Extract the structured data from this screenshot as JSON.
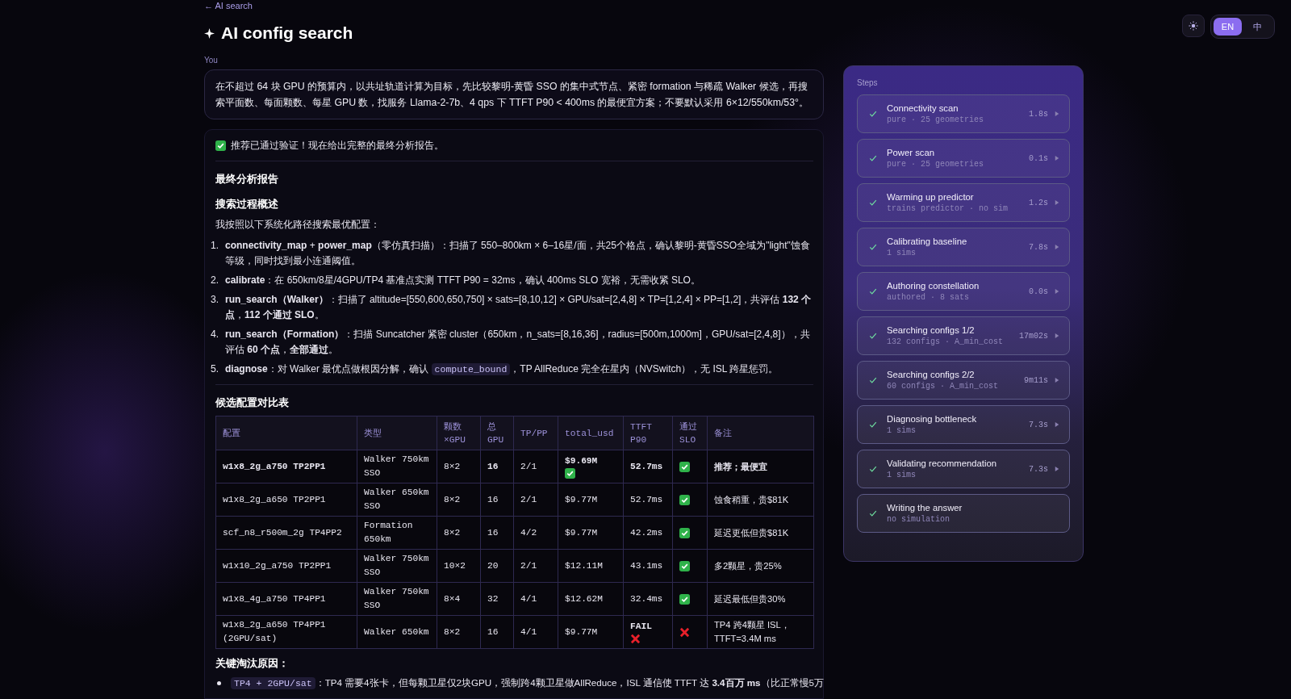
{
  "back_link": "← AI search",
  "title": "AI config search",
  "prompt": {
    "label": "You",
    "text": "在不超过 64 块 GPU 的预算内，以共址轨道计算为目标，先比较黎明-黄昏 SSO 的集中式节点、紧密 formation 与稀疏 Walker 候选，再搜索平面数、每面颗数、每星 GPU 数，找服务 Llama-2-7b、4 qps 下 TTFT P90 < 400ms 的最便宜方案；不要默认采用 6×12/550km/53°。"
  },
  "answer": {
    "verified": {
      "ok": true,
      "text": "推荐已通过验证！现在给出完整的最终分析报告。"
    },
    "heading": "最终分析报告",
    "subheading": "搜索过程概述",
    "intro": "我按照以下系统化路径搜索最优配置：",
    "steps_list": [
      {
        "num": "1.",
        "parts": [
          {
            "kind": "text",
            "text": "**connectivity_map** + **power_map**（零仿真扫描）：扫描了 550–800km × 6–16星/面，共25个格点，确认黎明-黄昏SSO全域为\"light\"蚀食等级，同时找到最小连通阈值。"
          }
        ]
      },
      {
        "num": "2.",
        "parts": [
          {
            "kind": "text",
            "text": "**calibrate**：在 650km/8星/4GPU/TP4 基准点实测 TTFT P90 = 32ms，确认 400ms SLO 宽裕，无需收紧 SLO。"
          }
        ]
      },
      {
        "num": "3.",
        "parts": [
          {
            "kind": "text",
            "text": "**run_search（Walker）**：扫描了 altitude=[550,600,650,750] × sats=[8,10,12] × GPU/sat=[2,4,8] × TP=[1,2,4] × PP=[1,2]，共评估 **132 个点**，**112 个通过 SLO**。"
          }
        ]
      },
      {
        "num": "4.",
        "parts": [
          {
            "kind": "text",
            "text": "**run_search（Formation）**：扫描 Suncatcher 紧密 cluster（650km，n_sats=[8,16,36]，radius=[500m,1000m]，GPU/sat=[2,4,8]），共评估 **60 个点**，**全部通过**。"
          }
        ]
      },
      {
        "num": "5.",
        "parts": [
          {
            "kind": "text",
            "text": "**diagnose**：对 Walker 最优点做根因分解，确认 "
          },
          {
            "kind": "code",
            "text": "compute_bound"
          },
          {
            "kind": "text",
            "text": "，TP AllReduce 完全在星内（NVSwitch），无 ISL 跨星惩罚。"
          }
        ]
      }
    ],
    "table_heading": "候选配置对比表",
    "table": {
      "columns": [
        "配置",
        "类型",
        "颗数 ×GPU",
        "总 GPU",
        "TP/PP",
        "total_usd",
        "TTFT P90",
        "通过 SLO",
        "备注"
      ],
      "rows": [
        {
          "recommended": true,
          "config": "w1x8_2g_a750 TP2PP1",
          "type": "Walker 750km SSO",
          "sats": "8×2",
          "gpus": "16",
          "tppp": "2/1",
          "usd": "$9.69M",
          "usd_ok": true,
          "ttft": "52.7ms",
          "ttft_fail": false,
          "pass": true,
          "note": "推荐；最便宜"
        },
        {
          "recommended": false,
          "config": "w1x8_2g_a650 TP2PP1",
          "type": "Walker 650km SSO",
          "sats": "8×2",
          "gpus": "16",
          "tppp": "2/1",
          "usd": "$9.77M",
          "usd_ok": false,
          "ttft": "52.7ms",
          "ttft_fail": false,
          "pass": true,
          "note": "蚀食稍重，贵$81K"
        },
        {
          "recommended": false,
          "config": "scf_n8_r500m_2g TP4PP2",
          "type": "Formation 650km",
          "sats": "8×2",
          "gpus": "16",
          "tppp": "4/2",
          "usd": "$9.77M",
          "usd_ok": false,
          "ttft": "42.2ms",
          "ttft_fail": false,
          "pass": true,
          "note": "延迟更低但贵$81K"
        },
        {
          "recommended": false,
          "config": "w1x10_2g_a750 TP2PP1",
          "type": "Walker 750km SSO",
          "sats": "10×2",
          "gpus": "20",
          "tppp": "2/1",
          "usd": "$12.11M",
          "usd_ok": false,
          "ttft": "43.1ms",
          "ttft_fail": false,
          "pass": true,
          "note": "多2颗星，贵25%"
        },
        {
          "recommended": false,
          "config": "w1x8_4g_a750 TP4PP1",
          "type": "Walker 750km SSO",
          "sats": "8×4",
          "gpus": "32",
          "tppp": "4/1",
          "usd": "$12.62M",
          "usd_ok": false,
          "ttft": "32.4ms",
          "ttft_fail": false,
          "pass": true,
          "note": "延迟最低但贵30%"
        },
        {
          "recommended": false,
          "config": "w1x8_2g_a650 TP4PP1 (2GPU/sat)",
          "type": "Walker 650km",
          "sats": "8×2",
          "gpus": "16",
          "tppp": "4/1",
          "usd": "$9.77M",
          "usd_ok": false,
          "ttft": "FAIL",
          "ttft_fail": true,
          "pass": false,
          "note": "TP4 跨4颗星 ISL，TTFT=3.4M ms"
        }
      ]
    },
    "reasons_heading": "关键淘汰原因：",
    "reasons": [
      {
        "parts": [
          {
            "kind": "code",
            "text": "TP4 + 2GPU/sat"
          },
          {
            "kind": "text",
            "text": "：TP4 需要4张卡，但每颗卫星仅2块GPU，强制跨4颗卫星做AllReduce，ISL 通信使 TTFT 达 **3.4百万 ms**（比正常慢5万"
          }
        ]
      }
    ]
  },
  "steps": {
    "title": "Steps",
    "items": [
      {
        "title": "Connectivity scan",
        "detail": "pure · 25 geometries",
        "time": "1.8s",
        "done": true
      },
      {
        "title": "Power scan",
        "detail": "pure · 25 geometries",
        "time": "0.1s",
        "done": true
      },
      {
        "title": "Warming up predictor",
        "detail": "trains predictor · no sim",
        "time": "1.2s",
        "done": true
      },
      {
        "title": "Calibrating baseline",
        "detail": "1 sims",
        "time": "7.8s",
        "done": true
      },
      {
        "title": "Authoring constellation",
        "detail": "authored · 8 sats",
        "time": "0.0s",
        "done": true
      },
      {
        "title": "Searching configs 1/2",
        "detail": "132 configs · A_min_cost",
        "time": "17m02s",
        "done": true
      },
      {
        "title": "Searching configs 2/2",
        "detail": "60 configs · A_min_cost",
        "time": "9m11s",
        "done": true
      },
      {
        "title": "Diagnosing bottleneck",
        "detail": "1 sims",
        "time": "7.3s",
        "done": true
      },
      {
        "title": "Validating recommendation",
        "detail": "1 sims",
        "time": "7.3s",
        "done": true
      },
      {
        "title": "Writing the answer",
        "detail": "no simulation",
        "done": true
      }
    ]
  },
  "languages": [
    {
      "label": "EN",
      "selected": true
    },
    {
      "label": "中",
      "selected": false
    }
  ]
}
